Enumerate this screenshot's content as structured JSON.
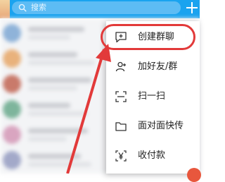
{
  "search": {
    "placeholder": "搜索"
  },
  "menu": {
    "items": [
      {
        "label": "创建群聊",
        "icon": "chat-plus-icon"
      },
      {
        "label": "加好友/群",
        "icon": "add-friend-icon"
      },
      {
        "label": "扫一扫",
        "icon": "scan-icon"
      },
      {
        "label": "面对面快传",
        "icon": "folder-transfer-icon"
      },
      {
        "label": "收付款",
        "icon": "yen-payment-icon"
      }
    ]
  },
  "colors": {
    "header": "#1aa3ef",
    "annotation": "#e23a3a"
  }
}
